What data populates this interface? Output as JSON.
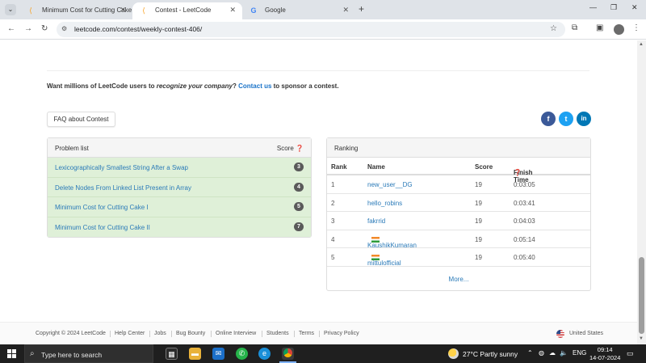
{
  "browser": {
    "tabs": [
      {
        "title": "Minimum Cost for Cutting Cake",
        "favicon": "leetcode-icon",
        "active": false
      },
      {
        "title": "Contest - LeetCode",
        "favicon": "leetcode-icon",
        "active": true
      },
      {
        "title": "Google",
        "favicon": "google-icon",
        "active": false
      }
    ],
    "url": "leetcode.com/contest/weekly-contest-406/",
    "new_tab": "+"
  },
  "sponsor": {
    "before": "Want millions of LeetCode users to ",
    "emphasis": "recognize your company",
    "middle": "? ",
    "link": "Contact us",
    "after": " to sponsor a contest."
  },
  "faq_button": "FAQ about Contest",
  "social": {
    "facebook": "f",
    "twitter": "t",
    "linkedin": "in"
  },
  "problems": {
    "header": "Problem list",
    "score_label": "Score",
    "items": [
      {
        "title": "Lexicographically Smallest String After a Swap",
        "score": "3"
      },
      {
        "title": "Delete Nodes From Linked List Present in Array",
        "score": "4"
      },
      {
        "title": "Minimum Cost for Cutting Cake I",
        "score": "5"
      },
      {
        "title": "Minimum Cost for Cutting Cake II",
        "score": "7"
      }
    ]
  },
  "ranking": {
    "header": "Ranking",
    "columns": {
      "rank": "Rank",
      "name": "Name",
      "score": "Score",
      "time": "Finish Time"
    },
    "rows": [
      {
        "rank": "1",
        "name": "new_user__DG",
        "score": "19",
        "time": "0:03:05",
        "flag": false
      },
      {
        "rank": "2",
        "name": "hello_robins",
        "score": "19",
        "time": "0:03:41",
        "flag": false
      },
      {
        "rank": "3",
        "name": "fakrrid",
        "score": "19",
        "time": "0:04:03",
        "flag": false
      },
      {
        "rank": "4",
        "name": "KaushikKumaran",
        "score": "19",
        "time": "0:05:14",
        "flag": true
      },
      {
        "rank": "5",
        "name": "mittulofficial",
        "score": "19",
        "time": "0:05:40",
        "flag": true
      }
    ],
    "more": "More..."
  },
  "footer": {
    "copyright": "Copyright © 2024 LeetCode",
    "links": [
      "Help Center",
      "Jobs",
      "Bug Bounty",
      "Online Interview",
      "Students",
      "Terms",
      "Privacy Policy"
    ],
    "region": "United States"
  },
  "taskbar": {
    "search_placeholder": "Type here to search",
    "weather": "27°C  Partly sunny",
    "language": "ENG",
    "time": "09:14",
    "date": "14-07-2024"
  },
  "colors": {
    "accent": "#2a7ab8",
    "solved_row": "#dff0d8",
    "facebook": "#3b5998",
    "twitter": "#1da1f2",
    "linkedin": "#0077b5"
  }
}
